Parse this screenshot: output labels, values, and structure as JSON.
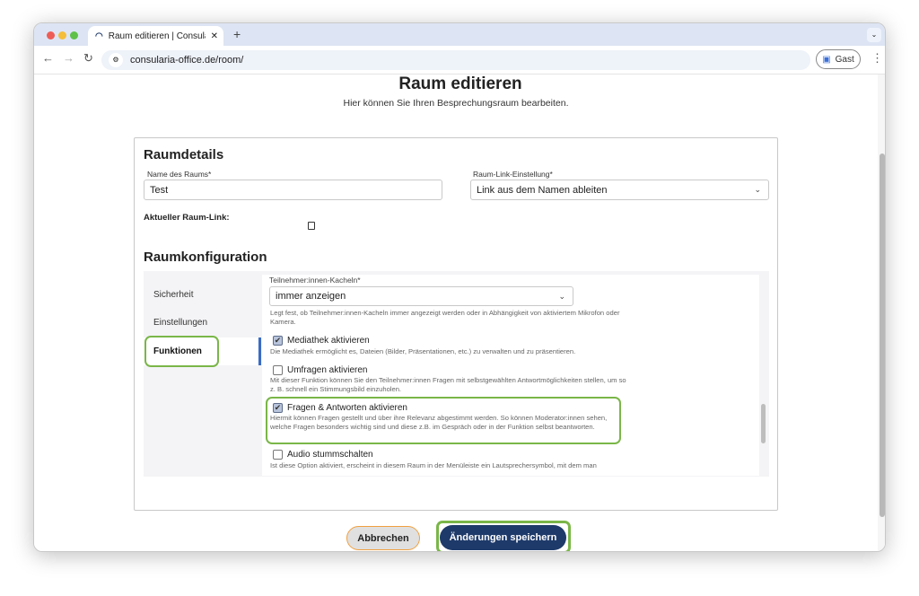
{
  "browser": {
    "tab_title": "Raum editieren | Consularia O",
    "url": "consularia-office.de/room/",
    "profile": "Gast"
  },
  "page": {
    "title": "Raum editieren",
    "subtitle": "Hier können Sie Ihren Besprechungsraum bearbeiten."
  },
  "details": {
    "heading": "Raumdetails",
    "name_label": "Name des Raums*",
    "name_value": "Test",
    "link_setting_label": "Raum-Link-Einstellung*",
    "link_setting_value": "Link aus dem Namen ableiten",
    "current_link_label": "Aktueller Raum-Link:"
  },
  "config": {
    "heading": "Raumkonfiguration",
    "nav": [
      "Sicherheit",
      "Einstellungen",
      "Funktionen"
    ],
    "tiles_label": "Teilnehmer:innen-Kacheln*",
    "tiles_value": "immer anzeigen",
    "tiles_help": "Legt fest, ob Teilnehmer:innen-Kacheln immer angezeigt werden oder in Abhängigkeit von aktiviertem Mikrofon oder Kamera.",
    "options": [
      {
        "label": "Mediathek aktivieren",
        "checked": true,
        "help": "Die Mediathek ermöglicht es, Dateien (Bilder, Präsentationen, etc.) zu verwalten und zu präsentieren."
      },
      {
        "label": "Umfragen aktivieren",
        "checked": false,
        "help": "Mit dieser Funktion können Sie den Teilnehmer:innen Fragen mit selbstgewählten Antwortmöglichkeiten stellen, um so z. B. schnell ein Stimmungsbild einzuholen."
      },
      {
        "label": "Fragen & Antworten aktivieren",
        "checked": true,
        "help": "Hiermit können Fragen gestellt und über ihre Relevanz abgestimmt werden. So können Moderator:innen sehen, welche Fragen besonders wichtig sind und diese z.B. im Gespräch oder in der Funktion selbst beantworten."
      },
      {
        "label": "Audio stummschalten",
        "checked": false,
        "help": "Ist diese Option aktiviert, erscheint in diesem Raum in der Menüleiste ein Lautsprechersymbol, mit dem man"
      }
    ]
  },
  "actions": {
    "cancel": "Abbrechen",
    "save": "Änderungen speichern"
  },
  "colors": {
    "primary": "#1e3a6a",
    "highlight": "#7ab648",
    "cancel_outline": "#f0a040"
  }
}
